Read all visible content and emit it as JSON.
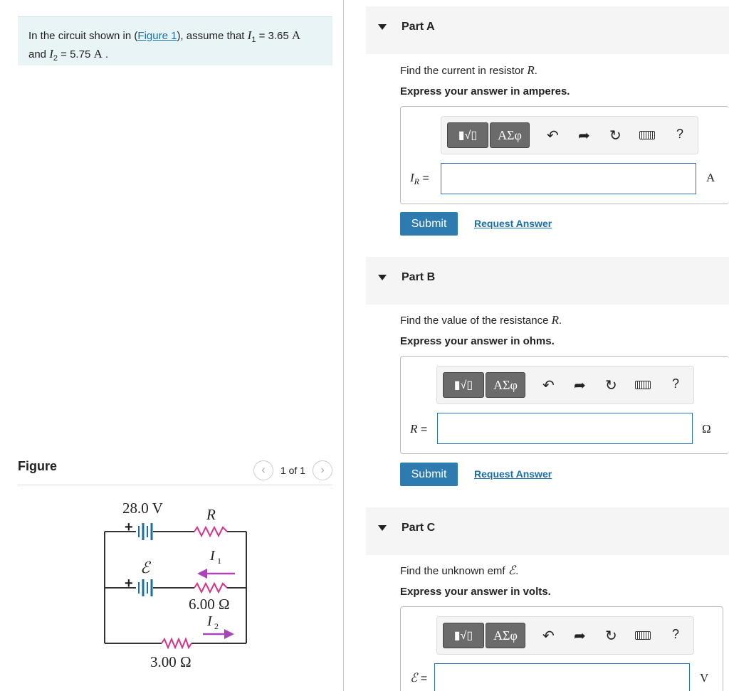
{
  "problem": {
    "text_prefix": "In the circuit shown in (",
    "figure_link": "Figure 1",
    "text_mid": "), assume that ",
    "i1_symbol": "I",
    "i1_sub": "1",
    "i1_value": " = 3.65 ",
    "i1_unit": "A",
    "and_text": "and ",
    "i2_symbol": "I",
    "i2_sub": "2",
    "i2_value": " = 5.75 ",
    "i2_unit": "A",
    "end": " ."
  },
  "figure": {
    "title": "Figure",
    "pager_text": "1 of 1",
    "prev_icon": "chevron-left-icon",
    "next_icon": "chevron-right-icon",
    "circuit": {
      "battery_top_label": "28.0 V",
      "emf_label": "ℰ",
      "resistor_r_label": "R",
      "i1_label": "I",
      "i1_sub": "1",
      "resistor_mid_label": "6.00 Ω",
      "i2_label": "I",
      "i2_sub": "2",
      "resistor_bottom_label": "3.00 Ω",
      "plus": "+",
      "wire_color": "#333333",
      "resistor_color": "#d6338a",
      "arrow_color": "#a845b8",
      "battery_color": "#1a6fa8"
    }
  },
  "toolbar": {
    "templates_label": "▮√▯",
    "greek_label": "ΑΣφ",
    "undo_icon": "undo-icon",
    "redo_icon": "redo-icon",
    "reset_icon": "reset-icon",
    "keyboard_icon": "keyboard-icon",
    "help_label": "?"
  },
  "parts": [
    {
      "title": "Part A",
      "prompt_prefix": "Find the current in resistor ",
      "prompt_symbol": "R",
      "prompt_suffix": ".",
      "instruction": "Express your answer in amperes.",
      "answer_label_symbol": "I",
      "answer_label_sub": "R",
      "answer_label_eq": " =",
      "answer_value": "",
      "unit": "A",
      "submit": "Submit",
      "request": "Request Answer"
    },
    {
      "title": "Part B",
      "prompt_prefix": "Find the value of the resistance ",
      "prompt_symbol": "R",
      "prompt_suffix": ".",
      "instruction": "Express your answer in ohms.",
      "answer_label_symbol": "R",
      "answer_label_eq": " =",
      "answer_value": "",
      "unit": "Ω",
      "submit": "Submit",
      "request": "Request Answer"
    },
    {
      "title": "Part C",
      "prompt_prefix": "Find the unknown emf ",
      "prompt_symbol": "ℰ",
      "prompt_suffix": ".",
      "instruction": "Express your answer in volts.",
      "answer_label_symbol": "ℰ",
      "answer_label_eq": " =",
      "answer_value": "",
      "unit": "V"
    }
  ]
}
